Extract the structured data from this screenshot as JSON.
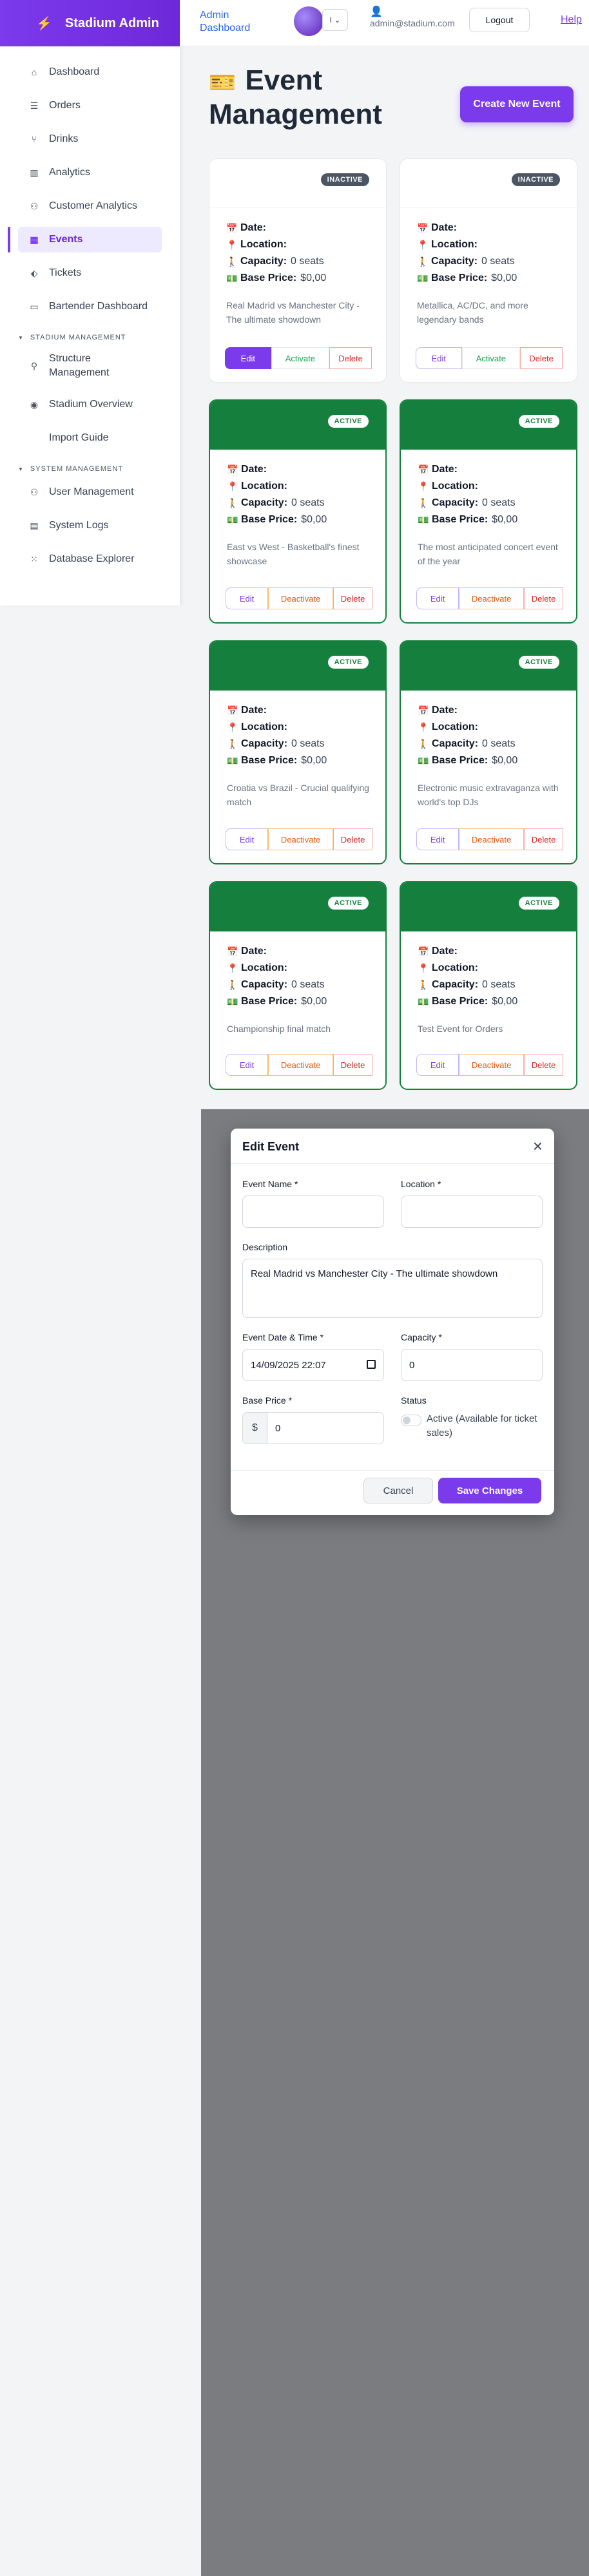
{
  "app": {
    "title": "Stadium Admin"
  },
  "sidebar": {
    "items": [
      {
        "label": "Dashboard",
        "icon": "home-icon"
      },
      {
        "label": "Orders",
        "icon": "list-icon"
      },
      {
        "label": "Drinks",
        "icon": "drink-icon"
      },
      {
        "label": "Analytics",
        "icon": "bar-chart-icon"
      },
      {
        "label": "Customer Analytics",
        "icon": "users-icon"
      },
      {
        "label": "Events",
        "icon": "calendar-icon",
        "active": true
      },
      {
        "label": "Tickets",
        "icon": "ticket-icon"
      },
      {
        "label": "Bartender Dashboard",
        "icon": "monitor-icon"
      }
    ],
    "sections": [
      {
        "title": "STADIUM MANAGEMENT",
        "items": [
          {
            "label": "Structure Management",
            "icon": "pin-icon"
          },
          {
            "label": "Stadium Overview",
            "icon": "eye-icon"
          },
          {
            "label": "Import Guide",
            "icon": ""
          }
        ]
      },
      {
        "title": "SYSTEM MANAGEMENT",
        "items": [
          {
            "label": "User Management",
            "icon": "users-icon"
          },
          {
            "label": "System Logs",
            "icon": "file-icon"
          },
          {
            "label": "Database Explorer",
            "icon": "grid-icon"
          }
        ]
      }
    ]
  },
  "topbar": {
    "title": "Admin Dashboard",
    "lang": "I",
    "email": "admin@stadium.com",
    "logout": "Logout",
    "help": "Help"
  },
  "page": {
    "title": "Event Management",
    "create_button": "Create New Event"
  },
  "labels": {
    "date": "Date:",
    "location": "Location:",
    "capacity": "Capacity:",
    "base_price": "Base Price:",
    "edit": "Edit",
    "activate": "Activate",
    "deactivate": "Deactivate",
    "delete": "Delete"
  },
  "events": [
    {
      "status": "INACTIVE",
      "capacity": "0 seats",
      "price": "$0,00",
      "description": "Real Madrid vs Manchester City - The ultimate showdown"
    },
    {
      "status": "INACTIVE",
      "capacity": "0 seats",
      "price": "$0,00",
      "description": "Metallica, AC/DC, and more legendary bands"
    },
    {
      "status": "ACTIVE",
      "capacity": "0 seats",
      "price": "$0,00",
      "description": "East vs West - Basketball's finest showcase"
    },
    {
      "status": "ACTIVE",
      "capacity": "0 seats",
      "price": "$0,00",
      "description": "The most anticipated concert event of the year"
    },
    {
      "status": "ACTIVE",
      "capacity": "0 seats",
      "price": "$0,00",
      "description": "Croatia vs Brazil - Crucial qualifying match"
    },
    {
      "status": "ACTIVE",
      "capacity": "0 seats",
      "price": "$0,00",
      "description": "Electronic music extravaganza with world's top DJs"
    },
    {
      "status": "ACTIVE",
      "capacity": "0 seats",
      "price": "$0,00",
      "description": "Championship final match"
    },
    {
      "status": "ACTIVE",
      "capacity": "0 seats",
      "price": "$0,00",
      "description": "Test Event for Orders"
    }
  ],
  "modal": {
    "title": "Edit Event",
    "event_name_label": "Event Name *",
    "event_name_value": "",
    "location_label": "Location *",
    "location_value": "",
    "description_label": "Description",
    "description_value": "Real Madrid vs Manchester City - The ultimate showdown",
    "datetime_label": "Event Date & Time *",
    "datetime_value": "14/09/2025 22:07",
    "capacity_label": "Capacity *",
    "capacity_value": "0",
    "base_price_label": "Base Price *",
    "base_price_prefix": "$",
    "base_price_value": "0",
    "status_label": "Status",
    "status_toggle_label": "Active (Available for ticket sales)",
    "cancel": "Cancel",
    "save": "Save Changes"
  },
  "colors": {
    "accent": "#7c3aed",
    "active_green": "#15803d",
    "inactive_badge": "#4b5563"
  }
}
